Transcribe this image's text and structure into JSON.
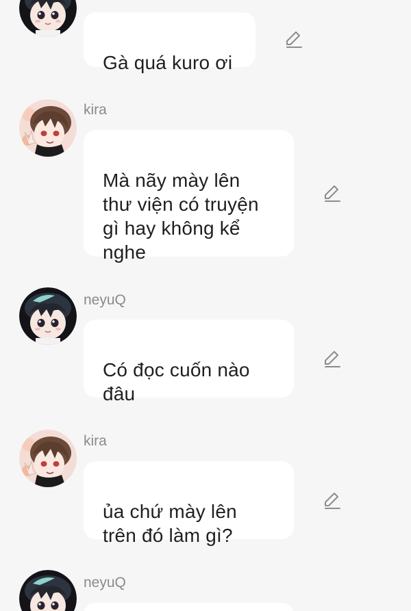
{
  "colors": {
    "background": "#f6f6f6",
    "bubble": "#ffffff",
    "sender_name": "#8a8a8a",
    "message_text": "#1f1f1f",
    "edit_icon": "#8c8c8c"
  },
  "messages": [
    {
      "sender": "",
      "avatar": "neyuq-avatar",
      "text": "Gà quá kuro ơi",
      "icon": "edit-icon"
    },
    {
      "sender": "kira",
      "avatar": "kira-avatar",
      "text": "Mà nãy mày lên\nthư viện có truyện\ngì hay không kể\nnghe",
      "icon": "edit-icon"
    },
    {
      "sender": "neyuQ",
      "avatar": "neyuq-avatar",
      "text": "Có đọc cuốn nào\nđâu",
      "icon": "edit-icon"
    },
    {
      "sender": "kira",
      "avatar": "kira-avatar",
      "text": "ủa chứ mày lên\ntrên đó làm gì?",
      "icon": "edit-icon"
    },
    {
      "sender": "neyuQ",
      "avatar": "neyuq-avatar",
      "text": "",
      "icon": ""
    }
  ]
}
